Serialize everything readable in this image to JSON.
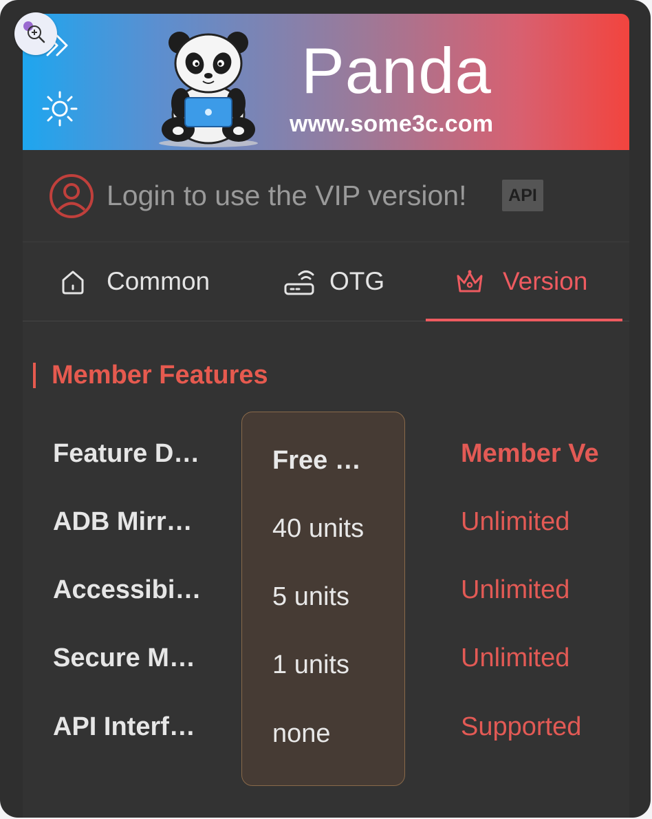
{
  "header": {
    "brand_title": "Panda",
    "brand_url": "www.some3c.com",
    "icons": {
      "expand": "double-chevron-right-icon",
      "theme": "sun-icon",
      "logo": "panda-logo",
      "zoom": "zoom-in-icon"
    }
  },
  "login": {
    "text": "Login to use the VIP version!",
    "badge": "API",
    "icon": "user-circle-icon"
  },
  "tabs": [
    {
      "label": "Common",
      "icon": "home-icon",
      "active": false
    },
    {
      "label": "OTG",
      "icon": "router-icon",
      "active": false
    },
    {
      "label": "Version",
      "icon": "crown-icon",
      "active": true
    }
  ],
  "section": {
    "title": "Member Features"
  },
  "table": {
    "headers": [
      "Feature D…",
      "Free …",
      "Member Ve"
    ],
    "rows": [
      [
        "ADB Mirr…",
        "40 units",
        "Unlimited"
      ],
      [
        "Accessibi…",
        "5 units",
        "Unlimited"
      ],
      [
        "Secure M…",
        "1 units",
        "Unlimited"
      ],
      [
        "API Interf…",
        "none",
        "Supported"
      ]
    ]
  },
  "colors": {
    "accent": "#ee5b60",
    "section_title": "#e65a4f",
    "panel_bg": "#333333",
    "free_column_bg": "#463b34",
    "banner_gradient": [
      "#1ea6ef",
      "#f2443e"
    ]
  }
}
